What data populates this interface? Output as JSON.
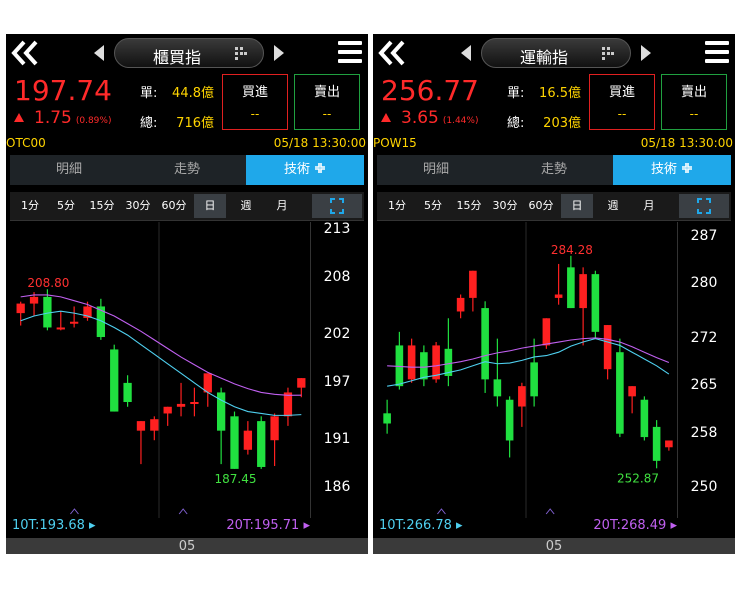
{
  "panels": [
    {
      "title": "櫃買指",
      "price": "197.74",
      "change": "1.75",
      "change_pct": "(0.89%)",
      "single_label": "單:",
      "single_value": "44.8億",
      "total_label": "總:",
      "total_value": "716億",
      "buy_label": "買進",
      "buy_value": "--",
      "sell_label": "賣出",
      "sell_value": "--",
      "code": "OTC00",
      "datetime": "05/18 13:30:00",
      "tabs": [
        "明細",
        "走勢",
        "技術"
      ],
      "periods": [
        "1分",
        "5分",
        "15分",
        "30分",
        "60分",
        "日",
        "週",
        "月"
      ],
      "selected_period": "日",
      "y_ticks": [
        "213",
        "208",
        "202",
        "197",
        "191",
        "186"
      ],
      "high_label": "208.80",
      "low_label": "187.45",
      "ma10": "10T:193.68",
      "ma20": "20T:195.71",
      "x_label": "05",
      "colors": {
        "up": "#ff2020",
        "down": "#20e040",
        "ma10": "#4fd0f0",
        "ma20": "#c060f0"
      },
      "chart_data": {
        "type": "candlestick",
        "ylim": [
          186,
          213
        ],
        "candles": [
          {
            "o": 204.3,
            "h": 205.5,
            "l": 203.0,
            "c": 205.3
          },
          {
            "o": 205.3,
            "h": 206.5,
            "l": 204.0,
            "c": 206.0
          },
          {
            "o": 206.0,
            "h": 206.8,
            "l": 202.5,
            "c": 202.8
          },
          {
            "o": 202.8,
            "h": 204.5,
            "l": 202.5,
            "c": 202.8
          },
          {
            "o": 203.2,
            "h": 205.0,
            "l": 202.8,
            "c": 203.4
          },
          {
            "o": 203.8,
            "h": 205.5,
            "l": 203.5,
            "c": 205.0
          },
          {
            "o": 205.0,
            "h": 205.8,
            "l": 201.5,
            "c": 201.8
          },
          {
            "o": 200.5,
            "h": 201.0,
            "l": 194.0,
            "c": 194.0
          },
          {
            "o": 197.0,
            "h": 197.8,
            "l": 194.5,
            "c": 195.0
          },
          {
            "o": 192.0,
            "h": 193.0,
            "l": 188.5,
            "c": 193.0
          },
          {
            "o": 192.0,
            "h": 193.5,
            "l": 191.0,
            "c": 193.2
          },
          {
            "o": 193.8,
            "h": 194.5,
            "l": 192.5,
            "c": 194.5
          },
          {
            "o": 194.5,
            "h": 197.0,
            "l": 193.5,
            "c": 194.8
          },
          {
            "o": 195.0,
            "h": 196.5,
            "l": 193.5,
            "c": 195.0
          },
          {
            "o": 196.0,
            "h": 198.0,
            "l": 194.5,
            "c": 198.0
          },
          {
            "o": 196.0,
            "h": 196.5,
            "l": 188.5,
            "c": 192.0
          },
          {
            "o": 193.5,
            "h": 194.0,
            "l": 188.0,
            "c": 188.0
          },
          {
            "o": 190.0,
            "h": 193.0,
            "l": 189.5,
            "c": 192.0
          },
          {
            "o": 193.0,
            "h": 193.5,
            "l": 188.0,
            "c": 188.2
          },
          {
            "o": 191.0,
            "h": 193.8,
            "l": 188.3,
            "c": 193.5
          },
          {
            "o": 193.5,
            "h": 196.5,
            "l": 192.5,
            "c": 196.0
          },
          {
            "o": 196.5,
            "h": 197.5,
            "l": 195.5,
            "c": 197.5
          }
        ],
        "ma10": [
          203.5,
          204.0,
          204.3,
          204.5,
          204.3,
          204.0,
          203.5,
          202.8,
          202.0,
          201.0,
          200.0,
          199.0,
          198.0,
          197.0,
          196.0,
          195.2,
          194.5,
          194.0,
          193.8,
          193.6,
          193.6,
          193.68
        ],
        "ma20": [
          206.0,
          206.2,
          206.2,
          206.0,
          205.6,
          205.2,
          204.6,
          204.0,
          203.2,
          202.4,
          201.5,
          200.6,
          199.7,
          198.9,
          198.1,
          197.5,
          196.9,
          196.4,
          196.0,
          195.8,
          195.7,
          195.71
        ]
      }
    },
    {
      "title": "運輸指",
      "price": "256.77",
      "change": "3.65",
      "change_pct": "(1.44%)",
      "single_label": "單:",
      "single_value": "16.5億",
      "total_label": "總:",
      "total_value": "203億",
      "buy_label": "買進",
      "buy_value": "--",
      "sell_label": "賣出",
      "sell_value": "--",
      "code": "POW15",
      "datetime": "05/18 13:30:00",
      "tabs": [
        "明細",
        "走勢",
        "技術"
      ],
      "periods": [
        "1分",
        "5分",
        "15分",
        "30分",
        "60分",
        "日",
        "週",
        "月"
      ],
      "selected_period": "日",
      "y_ticks": [
        "287",
        "280",
        "272",
        "265",
        "258",
        "250"
      ],
      "high_label": "284.28",
      "low_label": "252.87",
      "ma10": "10T:266.78",
      "ma20": "20T:268.49",
      "x_label": "05",
      "colors": {
        "up": "#ff2020",
        "down": "#20e040",
        "ma10": "#4fd0f0",
        "ma20": "#c060f0"
      },
      "chart_data": {
        "type": "candlestick",
        "ylim": [
          250,
          288
        ],
        "candles": [
          {
            "o": 261.0,
            "h": 263.0,
            "l": 258.0,
            "c": 259.5
          },
          {
            "o": 271.0,
            "h": 273.0,
            "l": 264.5,
            "c": 265.0
          },
          {
            "o": 266.0,
            "h": 272.0,
            "l": 265.5,
            "c": 271.0
          },
          {
            "o": 270.0,
            "h": 271.0,
            "l": 265.0,
            "c": 266.0
          },
          {
            "o": 266.0,
            "h": 271.5,
            "l": 265.5,
            "c": 271.0
          },
          {
            "o": 270.5,
            "h": 275.0,
            "l": 265.0,
            "c": 266.5
          },
          {
            "o": 276.0,
            "h": 278.5,
            "l": 275.0,
            "c": 278.0
          },
          {
            "o": 278.0,
            "h": 282.0,
            "l": 276.0,
            "c": 282.0
          },
          {
            "o": 276.5,
            "h": 277.5,
            "l": 264.0,
            "c": 266.0
          },
          {
            "o": 266.0,
            "h": 272.0,
            "l": 262.0,
            "c": 263.5
          },
          {
            "o": 263.0,
            "h": 263.5,
            "l": 254.5,
            "c": 257.0
          },
          {
            "o": 262.0,
            "h": 265.5,
            "l": 259.0,
            "c": 265.0
          },
          {
            "o": 268.5,
            "h": 272.0,
            "l": 262.0,
            "c": 263.5
          },
          {
            "o": 271.0,
            "h": 275.0,
            "l": 270.5,
            "c": 275.0
          },
          {
            "o": 278.0,
            "h": 283.0,
            "l": 277.0,
            "c": 278.5
          },
          {
            "o": 282.5,
            "h": 284.2,
            "l": 276.5,
            "c": 276.5
          },
          {
            "o": 276.5,
            "h": 282.5,
            "l": 271.0,
            "c": 281.5
          },
          {
            "o": 281.5,
            "h": 282.0,
            "l": 272.0,
            "c": 273.0
          },
          {
            "o": 267.5,
            "h": 274.0,
            "l": 266.0,
            "c": 274.0
          },
          {
            "o": 270.0,
            "h": 272.0,
            "l": 257.5,
            "c": 258.0
          },
          {
            "o": 263.5,
            "h": 265.0,
            "l": 261.0,
            "c": 265.0
          },
          {
            "o": 263.0,
            "h": 263.5,
            "l": 257.0,
            "c": 257.5
          },
          {
            "o": 259.0,
            "h": 260.0,
            "l": 252.9,
            "c": 254.0
          },
          {
            "o": 256.0,
            "h": 257.0,
            "l": 255.5,
            "c": 257.0
          }
        ],
        "ma10": [
          265.0,
          265.3,
          265.8,
          266.3,
          266.6,
          267.0,
          267.4,
          268.0,
          268.6,
          268.3,
          268.4,
          268.8,
          269.3,
          269.5,
          270.0,
          270.9,
          271.5,
          272.0,
          271.5,
          271.0,
          270.0,
          269.0,
          268.0,
          266.78
        ],
        "ma20": [
          268.0,
          267.9,
          267.8,
          267.8,
          268.0,
          268.3,
          268.6,
          269.0,
          269.5,
          269.9,
          270.2,
          270.6,
          270.9,
          271.2,
          271.5,
          271.8,
          272.0,
          272.1,
          271.9,
          271.5,
          270.8,
          270.0,
          269.2,
          268.49
        ]
      }
    }
  ]
}
